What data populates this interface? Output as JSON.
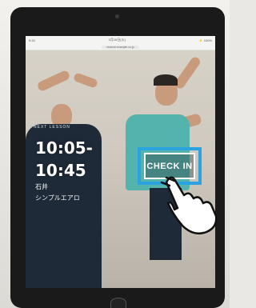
{
  "status_bar": {
    "time": "9:34",
    "date": "1月16日(火)",
    "battery": "⚡ 100%"
  },
  "url_bar": {
    "url": "reserve.example.co.jp"
  },
  "lesson": {
    "section_label": "NEXT LESSON",
    "start_time": "10:05-",
    "end_time": "10:45",
    "instructor": "石井",
    "name": "シンプルエアロ"
  },
  "checkin": {
    "label": "CHECK IN"
  },
  "icons": {
    "hand": "pointing-hand-icon",
    "camera": "front-camera-icon"
  },
  "colors": {
    "highlight": "#2aa3e0"
  }
}
